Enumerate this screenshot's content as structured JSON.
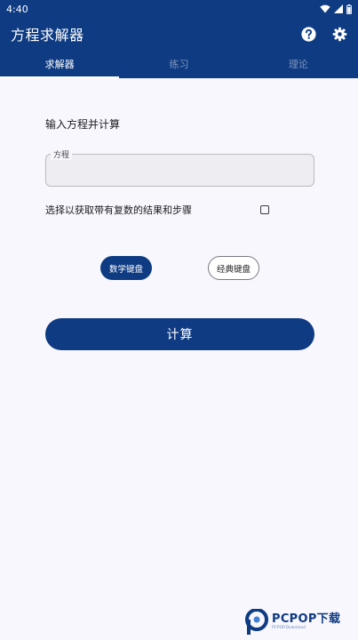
{
  "status_bar": {
    "time": "4:40"
  },
  "app_bar": {
    "title": "方程求解器",
    "icons": [
      "help-icon",
      "settings-icon"
    ]
  },
  "tabs": [
    {
      "label": "求解器",
      "active": true
    },
    {
      "label": "练习",
      "active": false
    },
    {
      "label": "理论",
      "active": false
    }
  ],
  "solver": {
    "heading": "输入方程并计算",
    "equation_label": "方程",
    "equation_value": "",
    "complex_option": {
      "label": "选择以获取带有复数的结果和步骤",
      "checked": false
    },
    "keyboards": {
      "math": "数学键盘",
      "classic": "经典键盘",
      "selected": "math"
    },
    "calculate": "计算"
  },
  "watermark": {
    "main": "PCPOP下载",
    "sub": "PCPOP.Download"
  },
  "colors": {
    "primary": "#0e3b82",
    "background": "#f8f7fd",
    "field": "#eeeef2"
  }
}
